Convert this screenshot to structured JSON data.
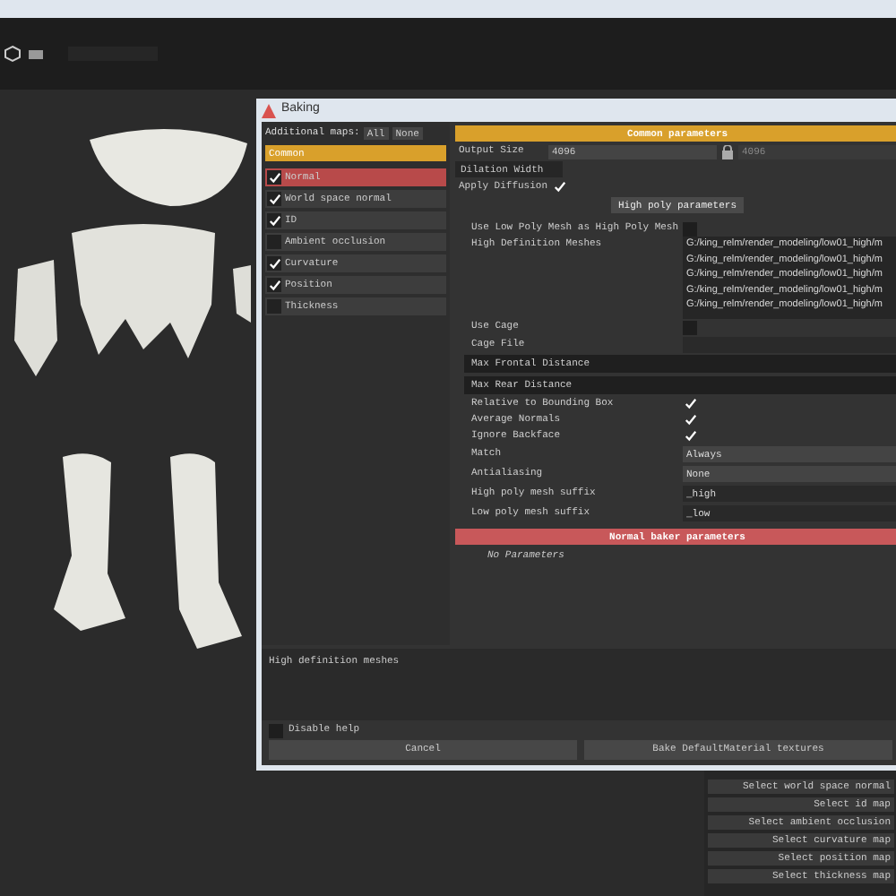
{
  "window": {
    "title": "Baking"
  },
  "maps_panel": {
    "label": "Additional maps:",
    "buttons": [
      "All",
      "None"
    ],
    "group": "Common",
    "maps": [
      {
        "label": "Normal",
        "checked": true,
        "selected": true
      },
      {
        "label": "World space normal",
        "checked": true,
        "selected": false
      },
      {
        "label": "ID",
        "checked": true,
        "selected": false
      },
      {
        "label": "Ambient occlusion",
        "checked": false,
        "selected": false
      },
      {
        "label": "Curvature",
        "checked": true,
        "selected": false
      },
      {
        "label": "Position",
        "checked": true,
        "selected": false
      },
      {
        "label": "Thickness",
        "checked": false,
        "selected": false
      }
    ]
  },
  "common_parameters": {
    "header": "Common parameters",
    "output_size": {
      "label": "Output Size",
      "value": "4096",
      "linked_value": "4096"
    },
    "dilation_width": {
      "label": "Dilation Width"
    },
    "apply_diffusion": {
      "label": "Apply Diffusion",
      "checked": true
    }
  },
  "high_poly": {
    "header": "High poly parameters",
    "rows": [
      {
        "kind": "checkbox",
        "label": "Use Low Poly Mesh as High Poly Mesh",
        "checked": false
      },
      {
        "kind": "list",
        "label": "High Definition Meshes",
        "items": [
          "G:/king_relm/render_modeling/low01_high/m",
          "G:/king_relm/render_modeling/low01_high/m",
          "G:/king_relm/render_modeling/low01_high/m",
          "G:/king_relm/render_modeling/low01_high/m",
          "G:/king_relm/render_modeling/low01_high/m"
        ]
      },
      {
        "kind": "checkbox",
        "label": "Use Cage",
        "checked": false
      },
      {
        "kind": "file",
        "label": "Cage File"
      },
      {
        "kind": "slider",
        "label": "Max Frontal Distance"
      },
      {
        "kind": "slider",
        "label": "Max Rear Distance"
      },
      {
        "kind": "checkbox",
        "label": "Relative to Bounding Box",
        "checked": true
      },
      {
        "kind": "checkbox",
        "label": "Average Normals",
        "checked": true
      },
      {
        "kind": "checkbox",
        "label": "Ignore Backface",
        "checked": true
      },
      {
        "kind": "select",
        "label": "Match",
        "value": "Always"
      },
      {
        "kind": "select",
        "label": "Antialiasing",
        "value": "None"
      },
      {
        "kind": "field",
        "label": "High poly mesh suffix",
        "value": "_high"
      },
      {
        "kind": "field",
        "label": "Low poly mesh suffix",
        "value": "_low"
      }
    ]
  },
  "normal_baker": {
    "header": "Normal baker parameters",
    "note": "No Parameters"
  },
  "help": {
    "text": "High definition meshes",
    "disable_help": {
      "label": "Disable help",
      "checked": false
    }
  },
  "buttons": [
    "Cancel",
    "Bake DefaultMaterial textures"
  ],
  "side_buttons": [
    "Select world space normal",
    "Select id map",
    "Select ambient occlusion",
    "Select curvature map",
    "Select position map",
    "Select thickness map"
  ]
}
